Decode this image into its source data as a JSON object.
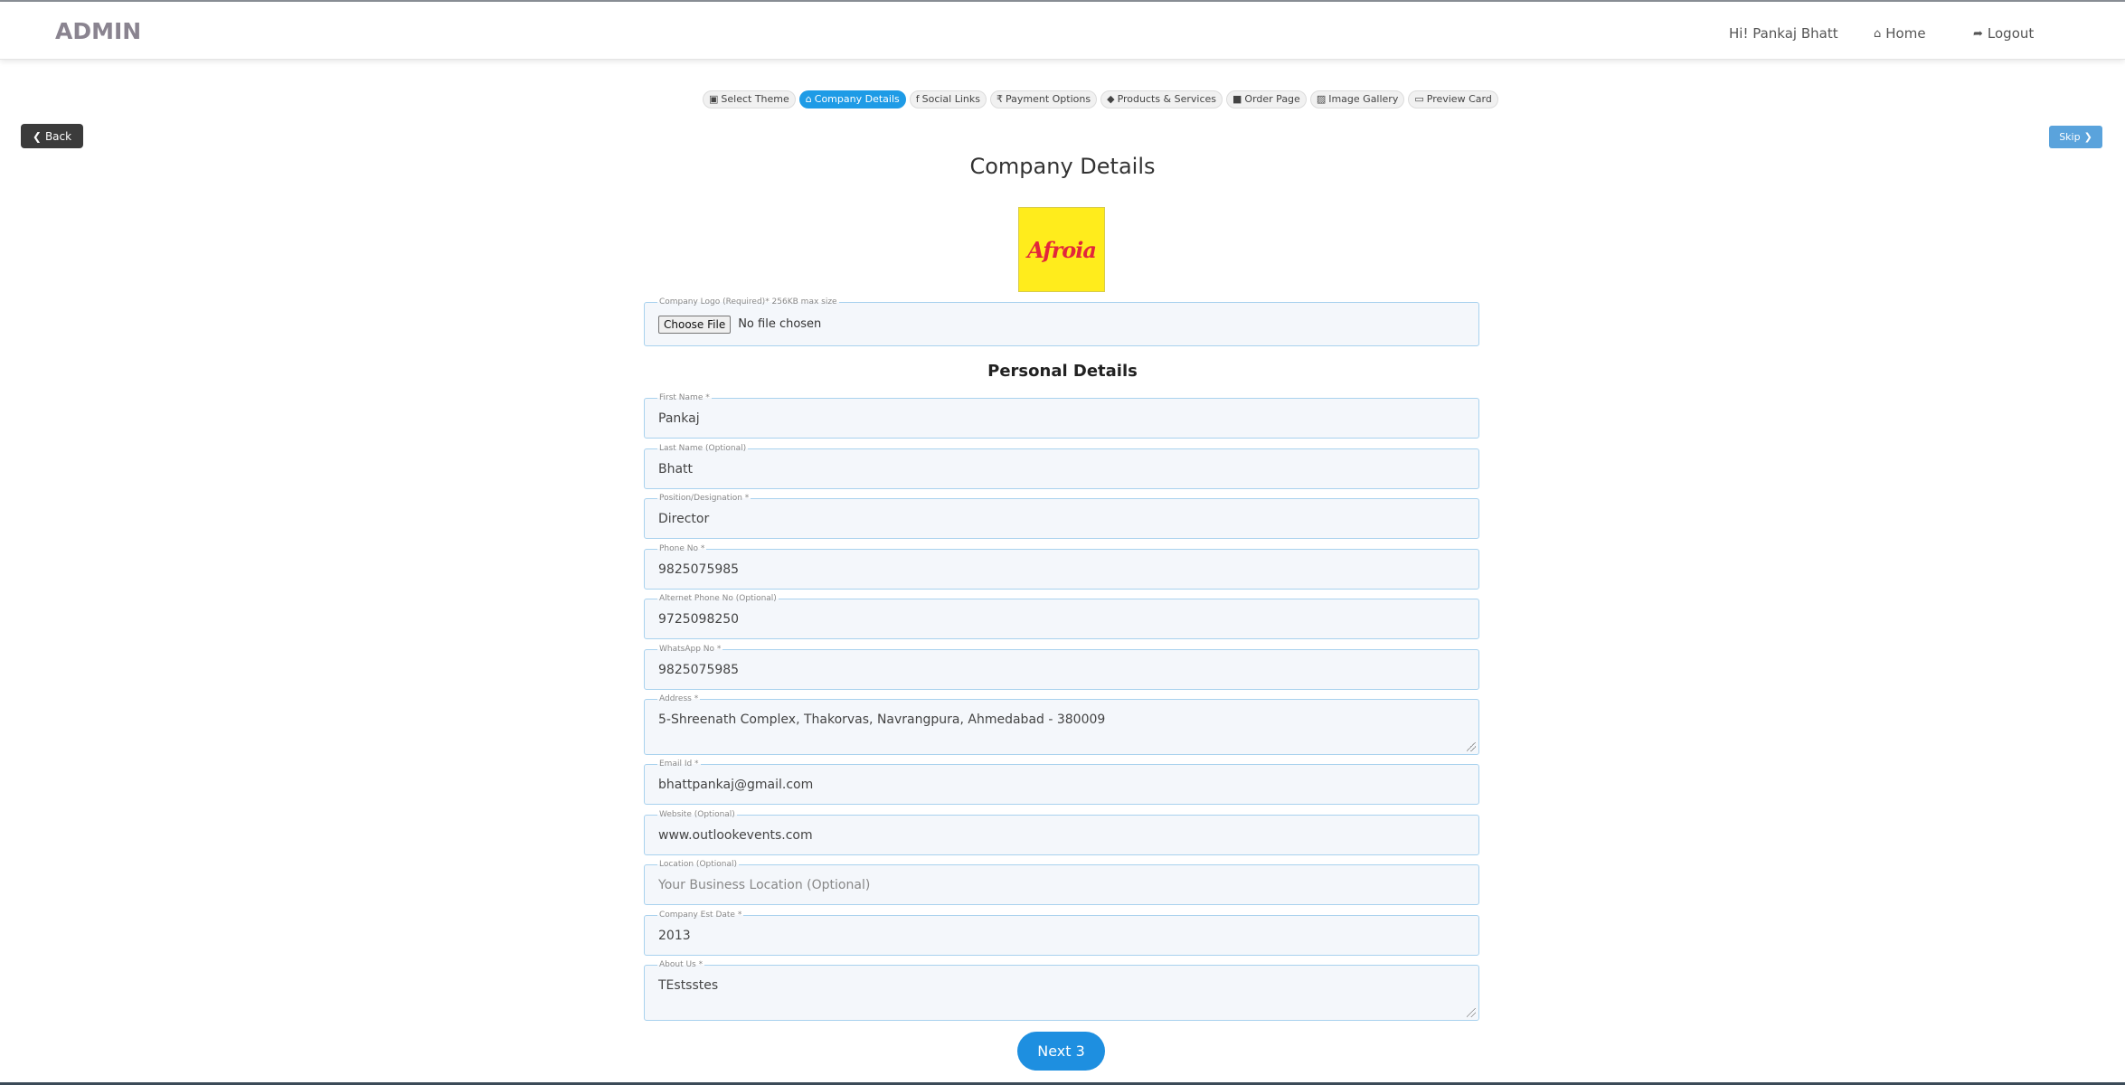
{
  "header": {
    "brand": "ADMIN",
    "greeting": "Hi! Pankaj Bhatt",
    "home_label": "Home",
    "logout_label": "Logout"
  },
  "steps": [
    {
      "label": "Select Theme",
      "icon": "map-icon",
      "glyph": "▣"
    },
    {
      "label": "Company Details",
      "icon": "bank-icon",
      "glyph": "⌂",
      "active": true
    },
    {
      "label": "Social Links",
      "icon": "facebook-icon",
      "glyph": "f"
    },
    {
      "label": "Payment Options",
      "icon": "rupee-icon",
      "glyph": "₹"
    },
    {
      "label": "Products & Services",
      "icon": "tag-icon",
      "glyph": "◆"
    },
    {
      "label": "Order Page",
      "icon": "cart-icon",
      "glyph": "■"
    },
    {
      "label": "Image Gallery",
      "icon": "image-icon",
      "glyph": "▨"
    },
    {
      "label": "Preview Card",
      "icon": "laptop-icon",
      "glyph": "▭"
    }
  ],
  "back_label": "Back",
  "skip_label": "Skip",
  "page_title": "Company Details",
  "logo_text": "Afroia",
  "logo_field": {
    "legend": "Company Logo (Required)* 256KB max size",
    "button": "Choose File",
    "status": "No file chosen"
  },
  "section_title": "Personal Details",
  "fields": {
    "first_name": {
      "legend": "First Name *",
      "value": "Pankaj"
    },
    "last_name": {
      "legend": "Last Name (Optional)",
      "value": "Bhatt"
    },
    "position": {
      "legend": "Position/Designation *",
      "value": "Director"
    },
    "phone": {
      "legend": "Phone No *",
      "value": "9825075985"
    },
    "alt_phone": {
      "legend": "Alternet Phone No (Optional)",
      "value": "9725098250"
    },
    "whatsapp": {
      "legend": "WhatsApp No *",
      "value": "9825075985"
    },
    "address": {
      "legend": "Address *",
      "value": "5-Shreenath Complex, Thakorvas, Navrangpura, Ahmedabad - 380009"
    },
    "email": {
      "legend": "Email Id *",
      "value": "bhattpankaj@gmail.com"
    },
    "website": {
      "legend": "Website (Optional)",
      "value": "www.outlookevents.com"
    },
    "location": {
      "legend": "Location (Optional)",
      "placeholder": "Your Business Location (Optional)"
    },
    "est_date": {
      "legend": "Company Est Date *",
      "value": "2013"
    },
    "about": {
      "legend": "About Us *",
      "value": "TEstsstes"
    }
  },
  "next_label": "Next 3"
}
